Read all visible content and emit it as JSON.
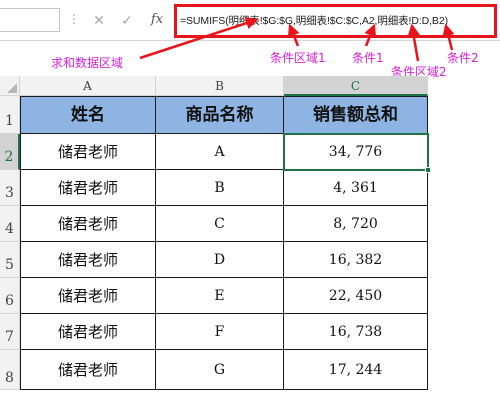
{
  "formula_bar": {
    "formula": "=SUMIFS(明细表!$G:$G,明细表!$C:$C,A2,明细表!D:D,B2)",
    "cancel_glyph": "✕",
    "confirm_glyph": "✓",
    "fx_glyph": "fx",
    "dots": "⋮"
  },
  "annotations": {
    "sum_range": "求和数据区域",
    "criteria_range_1": "条件区域1",
    "criteria_1": "条件1",
    "criteria_range_2": "条件区域2",
    "criteria_2": "条件2",
    "color": "#d61fd6",
    "highlight_color": "#e8131b"
  },
  "sheet": {
    "columns": [
      "A",
      "B",
      "C"
    ],
    "rows": [
      "1",
      "2",
      "3",
      "4",
      "5",
      "6",
      "7",
      "8"
    ],
    "active_column": "C",
    "active_row": "2",
    "header_fill": "#8db4e2",
    "header": [
      "姓名",
      "商品名称",
      "销售额总和"
    ],
    "data": [
      {
        "name": "储君老师",
        "product": "A",
        "total": "34, 776"
      },
      {
        "name": "储君老师",
        "product": "B",
        "total": "4, 361"
      },
      {
        "name": "储君老师",
        "product": "C",
        "total": "8, 720"
      },
      {
        "name": "储君老师",
        "product": "D",
        "total": "16, 382"
      },
      {
        "name": "储君老师",
        "product": "E",
        "total": "22, 450"
      },
      {
        "name": "储君老师",
        "product": "F",
        "total": "16, 738"
      },
      {
        "name": "储君老师",
        "product": "G",
        "total": "17, 244"
      }
    ]
  }
}
